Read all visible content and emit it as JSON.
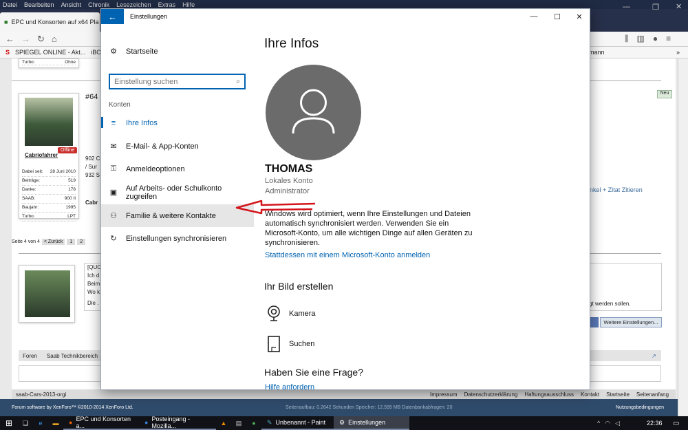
{
  "browser": {
    "menu": [
      "Datei",
      "Bearbeiten",
      "Ansicht",
      "Chronik",
      "Lesezeichen",
      "Extras",
      "Hilfe"
    ],
    "tab_title": "EPC und Konsorten auf x64 Pla",
    "bookmarks": [
      "SPIEGEL ONLINE - Akt...",
      "iBO"
    ],
    "bookmark_right": "ermann"
  },
  "forum": {
    "post_number": "#64 u",
    "user": "Cabriofahrer",
    "offline_label": "Offline",
    "new_badge": "Neu",
    "stats": [
      {
        "label": "Dabei seit:",
        "value": "28 Juni 2010"
      },
      {
        "label": "Beiträge:",
        "value": "519"
      },
      {
        "label": "Danke:",
        "value": "178"
      },
      {
        "label": "SAAB:",
        "value": "900 II"
      },
      {
        "label": "Baujahr:",
        "value": "1995"
      },
      {
        "label": "Turbo:",
        "value": "LPT"
      }
    ],
    "top_stat": {
      "label": "Turbo:",
      "value": "Ohne"
    },
    "post_lines": [
      "902 C",
      "/ Sur",
      "932 S"
    ],
    "cabr": "Cabr",
    "actions": "ankel + Zitat  Zitieren",
    "pagination_label": "Seite 4 von 4",
    "pagination_back": "< Zurück",
    "pages": [
      "1",
      "2"
    ],
    "reply_lines": [
      "[QUO",
      "Ich d",
      "Beim",
      "Wo k",
      "Die ."
    ],
    "reply_hint": "efügt werden sollen.",
    "more_settings": "Weitere Einstellungen...",
    "breadcrumb": [
      "Foren",
      "Saab Technikbereich"
    ],
    "style_name": "saab-Cars-2013-orgi",
    "footer_links": [
      "Impressum",
      "Datenschutzerklärung",
      "Haftungsausschluss",
      "Kontakt",
      "Startseite",
      "Seitenanfang"
    ],
    "copyright": "Forum software by XenForo™ ©2010-2014 XenForo Ltd.",
    "timing": "Seitenaufbau: 0.2642 Sekunden  Speicher: 12.595 MB  Datenbankabfragen: 20",
    "terms": "Nutzungsbedingungen"
  },
  "settings": {
    "window_title": "Einstellungen",
    "home": "Startseite",
    "search_placeholder": "Einstellung suchen",
    "section": "Konten",
    "nav": [
      {
        "label": "Ihre Infos",
        "icon": "≡"
      },
      {
        "label": "E-Mail- & App-Konten",
        "icon": "✉"
      },
      {
        "label": "Anmeldeoptionen",
        "icon": "⚿"
      },
      {
        "label": "Auf Arbeits- oder Schulkonto zugreifen",
        "icon": "▣"
      },
      {
        "label": "Familie & weitere Kontakte",
        "icon": "⚇"
      },
      {
        "label": "Einstellungen synchronisieren",
        "icon": "↻"
      }
    ],
    "heading": "Ihre Infos",
    "user_name": "THOMAS",
    "account_type": "Lokales Konto",
    "role": "Administrator",
    "info_text": "Windows wird optimiert, wenn Ihre Einstellungen und Dateien automatisch synchronisiert werden. Verwenden Sie ein Microsoft-Konto, um alle wichtigen Dinge auf allen Geräten zu synchronisieren.",
    "ms_link": "Stattdessen mit einem Microsoft-Konto anmelden",
    "picture_heading": "Ihr Bild erstellen",
    "camera": "Kamera",
    "browse": "Suchen",
    "question_heading": "Haben Sie eine Frage?",
    "help_link": "Hilfe anfordern"
  },
  "taskbar": {
    "tasks": [
      "EPC und Konsorten a...",
      "Posteingang - Mozilla...",
      "Unbenannt - Paint",
      "Einstellungen"
    ],
    "time": "22:36",
    "accent": "#0063b1"
  }
}
